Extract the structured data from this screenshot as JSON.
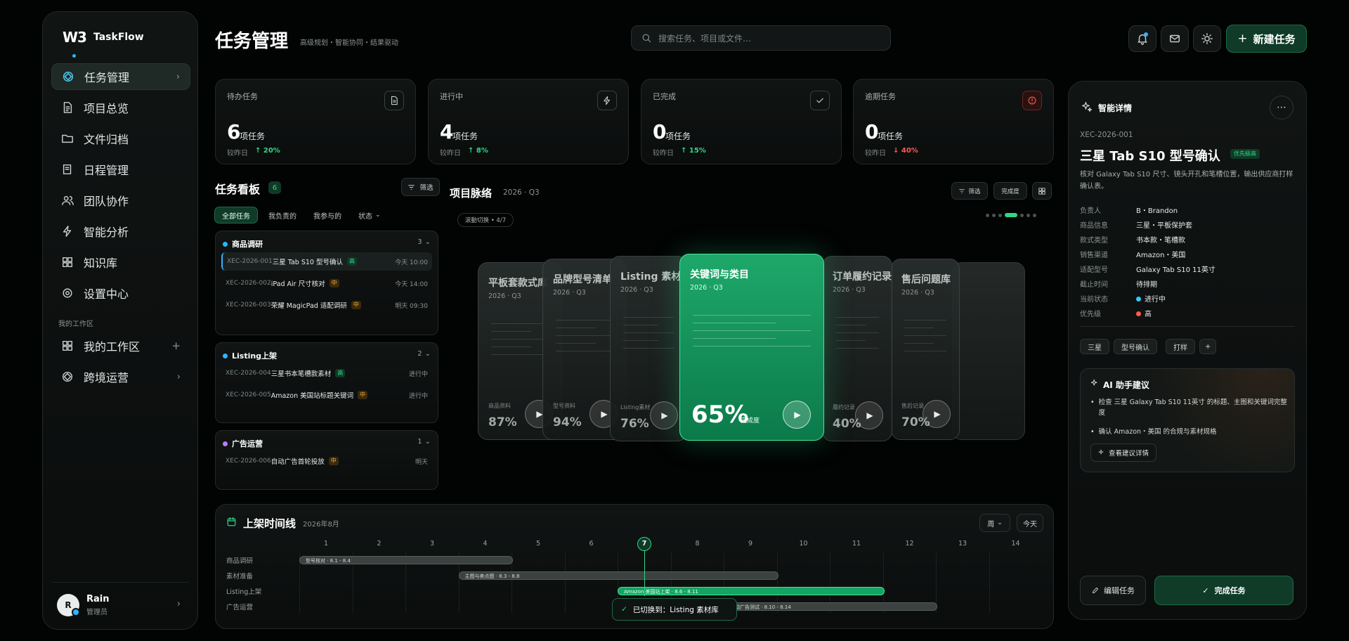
{
  "brand": {
    "logo": "W3",
    "name": "TaskFlow"
  },
  "sidebar": {
    "items": [
      {
        "label": "任务管理",
        "icon": "target-icon"
      },
      {
        "label": "项目总览",
        "icon": "document-icon"
      },
      {
        "label": "文件归档",
        "icon": "folder-icon"
      },
      {
        "label": "日程管理",
        "icon": "book-icon"
      },
      {
        "label": "团队协作",
        "icon": "users-icon"
      },
      {
        "label": "智能分析",
        "icon": "bolt-icon"
      },
      {
        "label": "知识库",
        "icon": "grid-icon"
      },
      {
        "label": "设置中心",
        "icon": "settings-icon"
      }
    ],
    "workspace_label": "我的工作区",
    "workspace_items": [
      {
        "label": "我的工作区"
      },
      {
        "label": "跨境运营"
      }
    ],
    "user": {
      "initial": "R",
      "name": "Rain",
      "role": "管理员"
    }
  },
  "header": {
    "title": "任务管理",
    "subtitle": "高级规划・智能协同・结果驱动",
    "search_placeholder": "搜索任务、项目或文件…",
    "new_task": "新建任务"
  },
  "stats": [
    {
      "label": "待办任务",
      "value": "6",
      "unit": "项任务",
      "compare": "较昨日",
      "change": "↑ 20%",
      "direction": "up"
    },
    {
      "label": "进行中",
      "value": "4",
      "unit": "项任务",
      "compare": "较昨日",
      "change": "↑ 8%",
      "direction": "up"
    },
    {
      "label": "已完成",
      "value": "0",
      "unit": "项任务",
      "compare": "较昨日",
      "change": "↑ 15%",
      "direction": "up"
    },
    {
      "label": "逾期任务",
      "value": "0",
      "unit": "项任务",
      "compare": "较昨日",
      "change": "↓ 40%",
      "direction": "down"
    }
  ],
  "board": {
    "title": "任务看板",
    "count": "6",
    "filter": "筛选",
    "tabs": [
      "全部任务",
      "我负责的",
      "我参与的",
      "状态"
    ],
    "groups": [
      {
        "name": "商品调研",
        "count": "3",
        "color": "#33b3ff",
        "tasks": [
          {
            "id": "XEC-2026-001",
            "title": "三星 Tab S10 型号确认",
            "priority": "高",
            "level": "hi",
            "time": "今天 10:00"
          },
          {
            "id": "XEC-2026-002",
            "title": "iPad Air 尺寸核对",
            "priority": "中",
            "level": "mid",
            "time": "今天 14:00"
          },
          {
            "id": "XEC-2026-003",
            "title": "荣耀 MagicPad 适配调研",
            "priority": "中",
            "level": "mid",
            "time": "明天 09:30"
          }
        ]
      },
      {
        "name": "Listing上架",
        "count": "2",
        "color": "#33b3ff",
        "tasks": [
          {
            "id": "XEC-2026-004",
            "title": "三星书本笔槽款素材",
            "priority": "高",
            "level": "hi",
            "time": "进行中"
          },
          {
            "id": "XEC-2026-005",
            "title": "Amazon 美国站标题关键词",
            "priority": "中",
            "level": "mid",
            "time": "进行中"
          }
        ]
      },
      {
        "name": "广告运营",
        "count": "1",
        "color": "#b57dff",
        "tasks": [
          {
            "id": "XEC-2026-006",
            "title": "自动广告首轮投放",
            "priority": "中",
            "level": "mid",
            "time": "明天"
          }
        ]
      }
    ]
  },
  "pulse": {
    "title": "项目脉络",
    "period": "2026 · Q3",
    "switch": "滚動切换 • 4/7",
    "filter": "筛选",
    "done": "完成度",
    "progress_index": 4,
    "progress_total": 7,
    "cards": [
      {
        "title": "平板套款式库",
        "year": "2026 · Q3",
        "label": "商品资料",
        "percent": "87%"
      },
      {
        "title": "品牌型号清单",
        "year": "2026 · Q3",
        "label": "型号资料",
        "percent": "94%"
      },
      {
        "title": "Listing 素材库",
        "year": "2026 · Q3",
        "label": "Listing素材",
        "percent": "76%"
      },
      {
        "title": "关键词与类目",
        "year": "2026 · Q3",
        "label": "完成度",
        "percent": "65%"
      },
      {
        "title": "订单履约记录",
        "year": "2026 · Q3",
        "label": "履约记录",
        "percent": "40%"
      },
      {
        "title": "售后问题库",
        "year": "2026 · Q3",
        "label": "售后记录",
        "percent": "70%"
      }
    ]
  },
  "timeline": {
    "title": "上架时间线",
    "month": "2026年8月",
    "view": "周",
    "today": "今天",
    "days": [
      "1",
      "2",
      "3",
      "4",
      "5",
      "6",
      "7",
      "8",
      "9",
      "10",
      "11",
      "12",
      "13",
      "14"
    ],
    "current_day": "7",
    "rows": [
      "商品调研",
      "素材准备",
      "Listing上架",
      "广告运营"
    ],
    "bars": [
      {
        "label": "型号核对 · 8.1 - 8.4",
        "start": 1,
        "end": 5
      },
      {
        "label": "主图与卖点图 · 8.3 - 8.8",
        "start": 4,
        "end": 10
      },
      {
        "label": "Amazon 美国站上架 · 8.6 - 8.11",
        "start": 7,
        "end": 12
      },
      {
        "label": "自动广告测试 · 8.10 - 8.14",
        "start": 9,
        "end": 13
      }
    ],
    "toast": "已切换到：Listing 素材库"
  },
  "detail": {
    "title_label": "智能详情",
    "code": "XEC-2026-001",
    "name": "三星 Tab S10 型号确认",
    "badge": "优先級高",
    "desc": "核对 Galaxy Tab S10 尺寸、镜头开孔和笔槽位置，输出供应商打样确认表。",
    "fields": [
      {
        "k": "负责人",
        "v": "B・Brandon"
      },
      {
        "k": "商品信息",
        "v": "三星・平板保护套"
      },
      {
        "k": "款式类型",
        "v": "书本款・笔槽款"
      },
      {
        "k": "销售渠道",
        "v": "Amazon・美国"
      },
      {
        "k": "适配型号",
        "v": "Galaxy Tab S10 11英寸"
      },
      {
        "k": "截止时间",
        "v": "待排期"
      },
      {
        "k": "当前状态",
        "v": "进行中"
      },
      {
        "k": "优先级",
        "v": "高"
      }
    ],
    "tags": [
      "三星",
      "型号确认",
      "打样",
      "+"
    ],
    "ai_title": "AI 助手建议",
    "ai_items": [
      "检查 三星 Galaxy Tab S10 11英寸 的标题、主图和关键词完整度",
      "确认 Amazon・美国 的合规与素材规格"
    ],
    "ai_link": "查看建议详情",
    "edit": "编辑任务",
    "complete": "完成任务"
  }
}
